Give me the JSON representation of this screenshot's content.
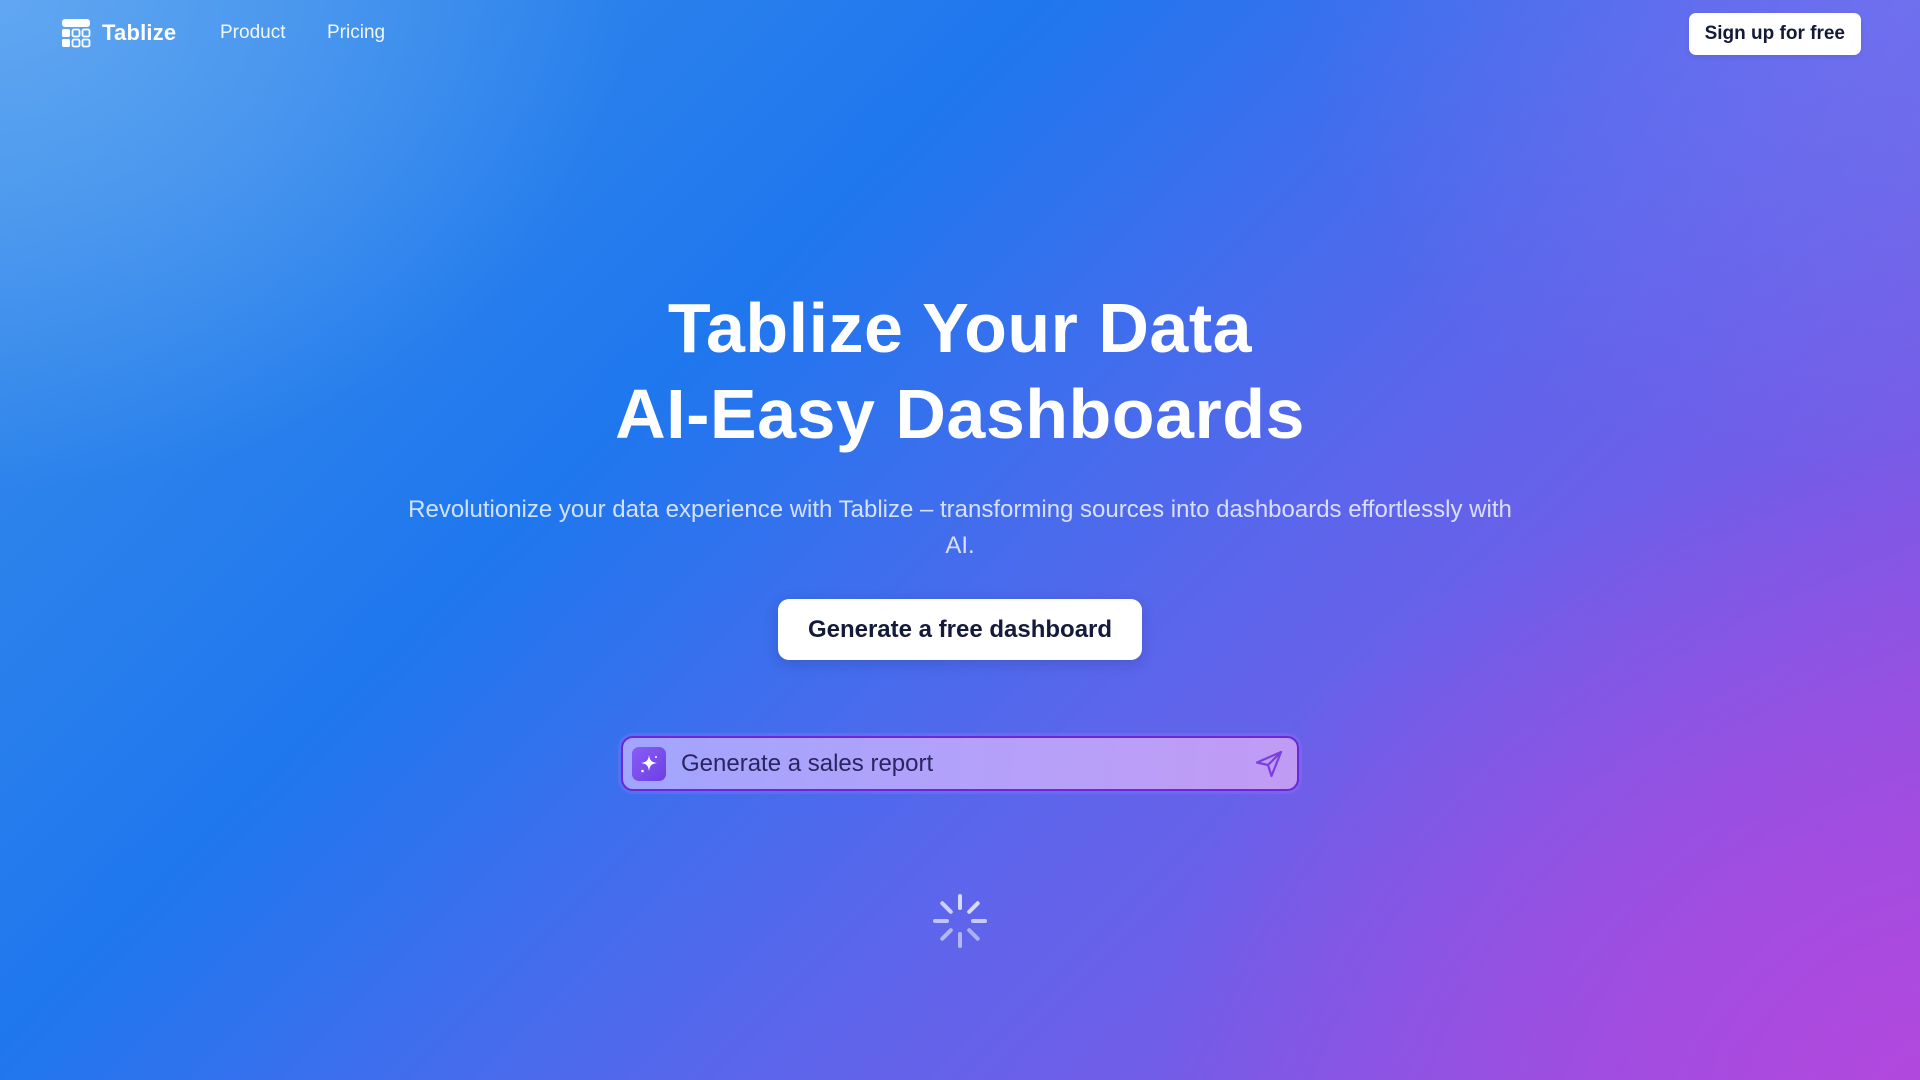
{
  "brand": {
    "name": "Tablize",
    "logo_icon": "table-grid-icon"
  },
  "nav": {
    "links": [
      {
        "label": "Product"
      },
      {
        "label": "Pricing"
      }
    ],
    "signup_label": "Sign up for free"
  },
  "hero": {
    "title_line1": "Tablize Your Data",
    "title_line2": "AI-Easy Dashboards",
    "subtitle": "Revolutionize your data experience with Tablize – transforming sources into dashboards effortlessly with AI.",
    "cta_label": "Generate a free dashboard"
  },
  "prompt": {
    "text": "Generate a sales report",
    "leading_icon": "sparkle-icon",
    "send_icon": "send-icon"
  },
  "status": {
    "loading_icon": "loading-spinner-icon"
  },
  "colors": {
    "accent_purple": "#6a28d6",
    "text_dark": "#141a3a",
    "background_blue": "#1f77ee",
    "background_violet": "#9b4de0"
  }
}
